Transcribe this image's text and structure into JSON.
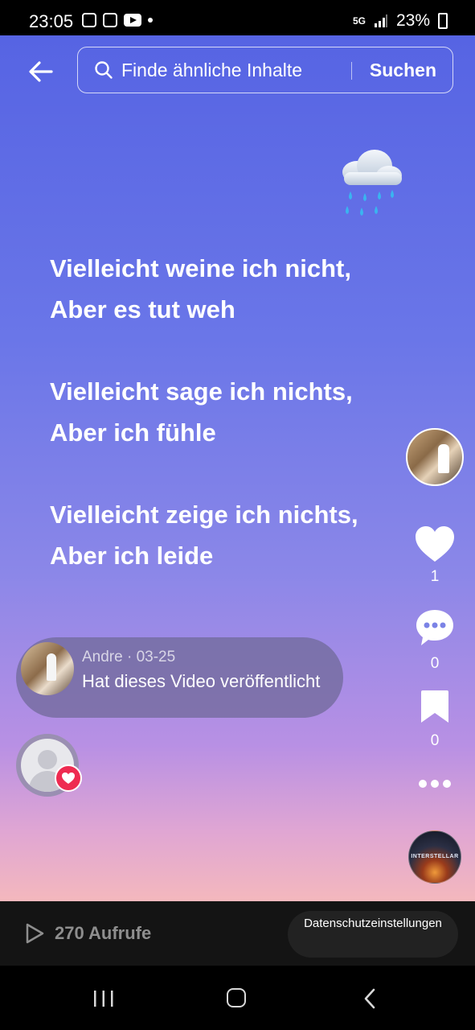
{
  "status_bar": {
    "time": "23:05",
    "network": "5G",
    "battery": "23%"
  },
  "header": {
    "search_placeholder": "Finde ähnliche Inhalte",
    "search_button": "Suchen"
  },
  "poem": {
    "stanzas": [
      [
        "Vielleicht weine ich nicht,",
        "Aber es tut weh"
      ],
      [
        "Vielleicht sage ich nichts,",
        "Aber ich fühle"
      ],
      [
        "Vielleicht zeige ich nichts,",
        "Aber ich leide"
      ]
    ]
  },
  "actions": {
    "likes": "1",
    "comments": "0",
    "bookmarks": "0"
  },
  "music_disc_label": "INTERSTELLAR",
  "comment_bubble": {
    "meta": "Andre · 03-25",
    "text": "Hat dieses Video veröffentlicht"
  },
  "bottom": {
    "views": "270 Aufrufe",
    "privacy_button": "Datenschutzeinstellungen"
  },
  "colors": {
    "gradient_top": "#5664e3",
    "gradient_bottom": "#f4b8bd",
    "heart_badge": "#ee2b51"
  }
}
